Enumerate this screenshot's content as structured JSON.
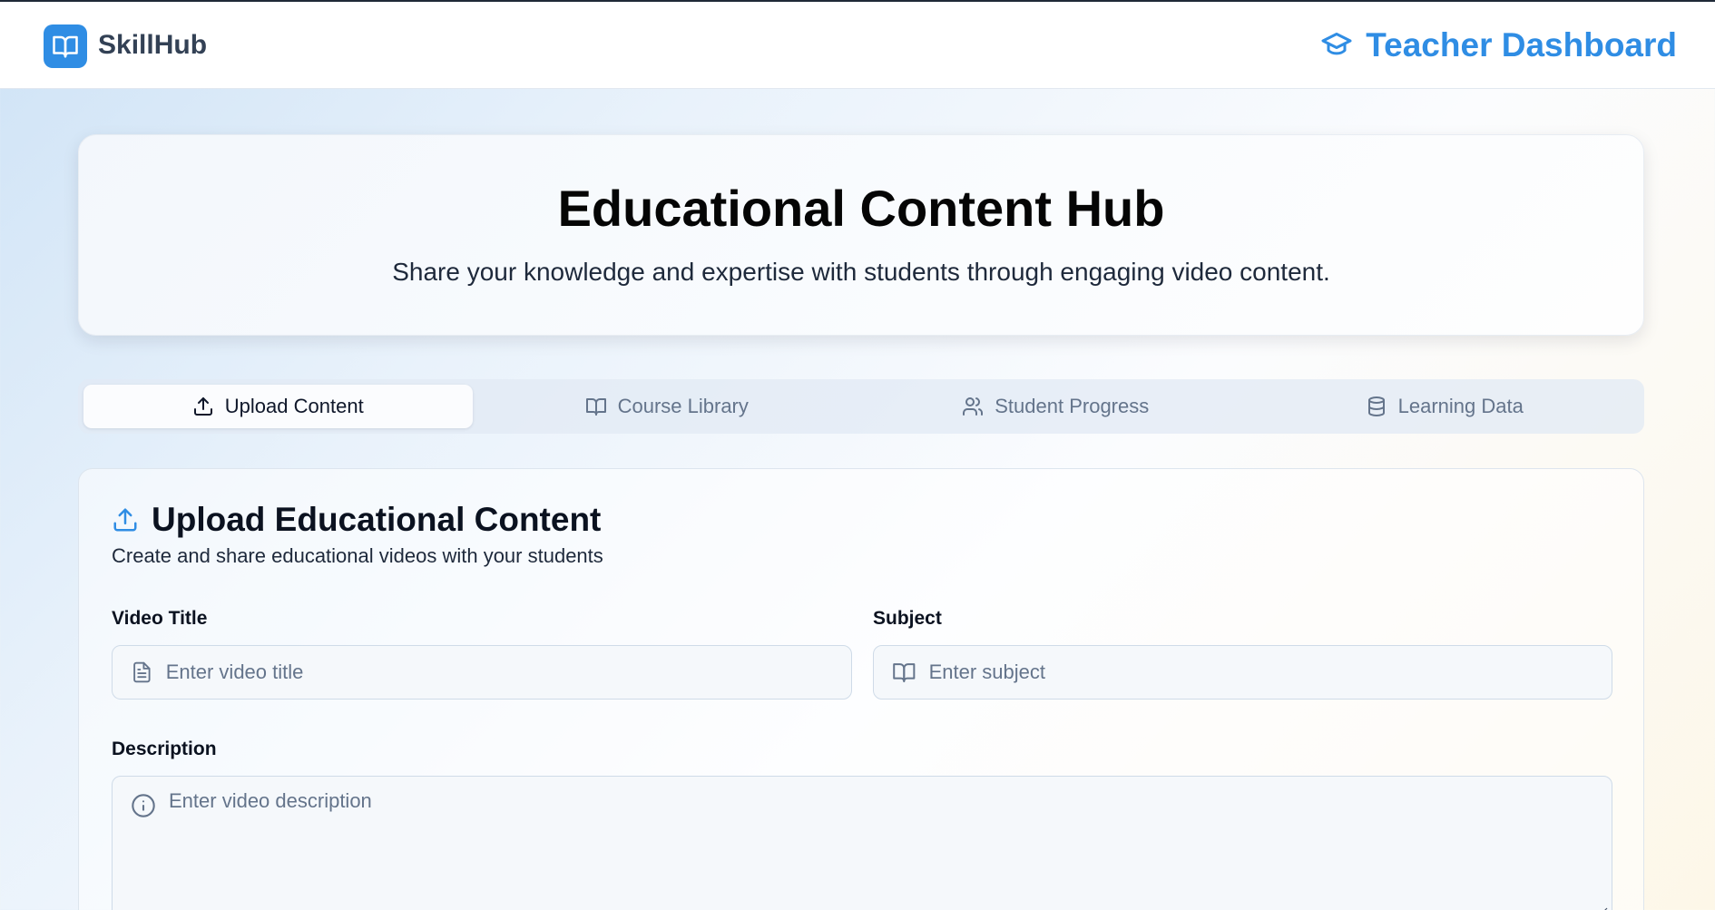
{
  "app": {
    "name": "SkillHub",
    "dashboard_title": "Teacher Dashboard",
    "accent_color": "#2f8de4"
  },
  "hero": {
    "title": "Educational Content Hub",
    "subtitle": "Share your knowledge and expertise with students through engaging video content."
  },
  "tabs": [
    {
      "label": "Upload Content",
      "icon": "upload-icon",
      "active": true
    },
    {
      "label": "Course Library",
      "icon": "book-open-icon",
      "active": false
    },
    {
      "label": "Student Progress",
      "icon": "users-icon",
      "active": false
    },
    {
      "label": "Learning Data",
      "icon": "database-icon",
      "active": false
    }
  ],
  "form": {
    "title": "Upload Educational Content",
    "subtitle": "Create and share educational videos with your students",
    "video_title": {
      "label": "Video Title",
      "placeholder": "Enter video title",
      "value": ""
    },
    "subject": {
      "label": "Subject",
      "placeholder": "Enter subject",
      "value": ""
    },
    "description": {
      "label": "Description",
      "placeholder": "Enter video description",
      "value": ""
    }
  }
}
